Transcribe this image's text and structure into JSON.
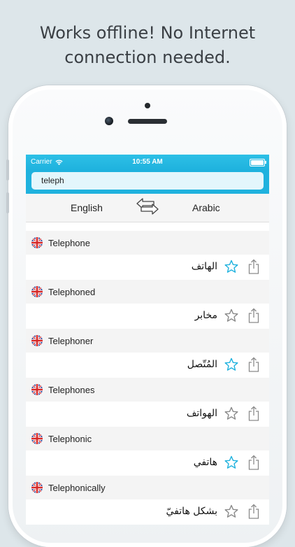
{
  "promo": {
    "line1": "Works offline! No Internet",
    "line2": "connection needed."
  },
  "status_bar": {
    "carrier": "Carrier",
    "time": "10:55 AM"
  },
  "search": {
    "value": "teleph"
  },
  "languages": {
    "source": "English",
    "target": "Arabic"
  },
  "colors": {
    "accent": "#1fb2de",
    "star_active": "#1fb2de",
    "star_inactive": "#8a8a8a"
  },
  "results": [
    {
      "word": "Telephone",
      "translation": "الهاتف",
      "starred": true
    },
    {
      "word": "Telephoned",
      "translation": "مخابر",
      "starred": false
    },
    {
      "word": "Telephoner",
      "translation": "المُتّصل",
      "starred": true
    },
    {
      "word": "Telephones",
      "translation": "الهواتف",
      "starred": false
    },
    {
      "word": "Telephonic",
      "translation": "هاتفي",
      "starred": true
    },
    {
      "word": "Telephonically",
      "translation": "بشكل هاتفيّ",
      "starred": false
    }
  ]
}
